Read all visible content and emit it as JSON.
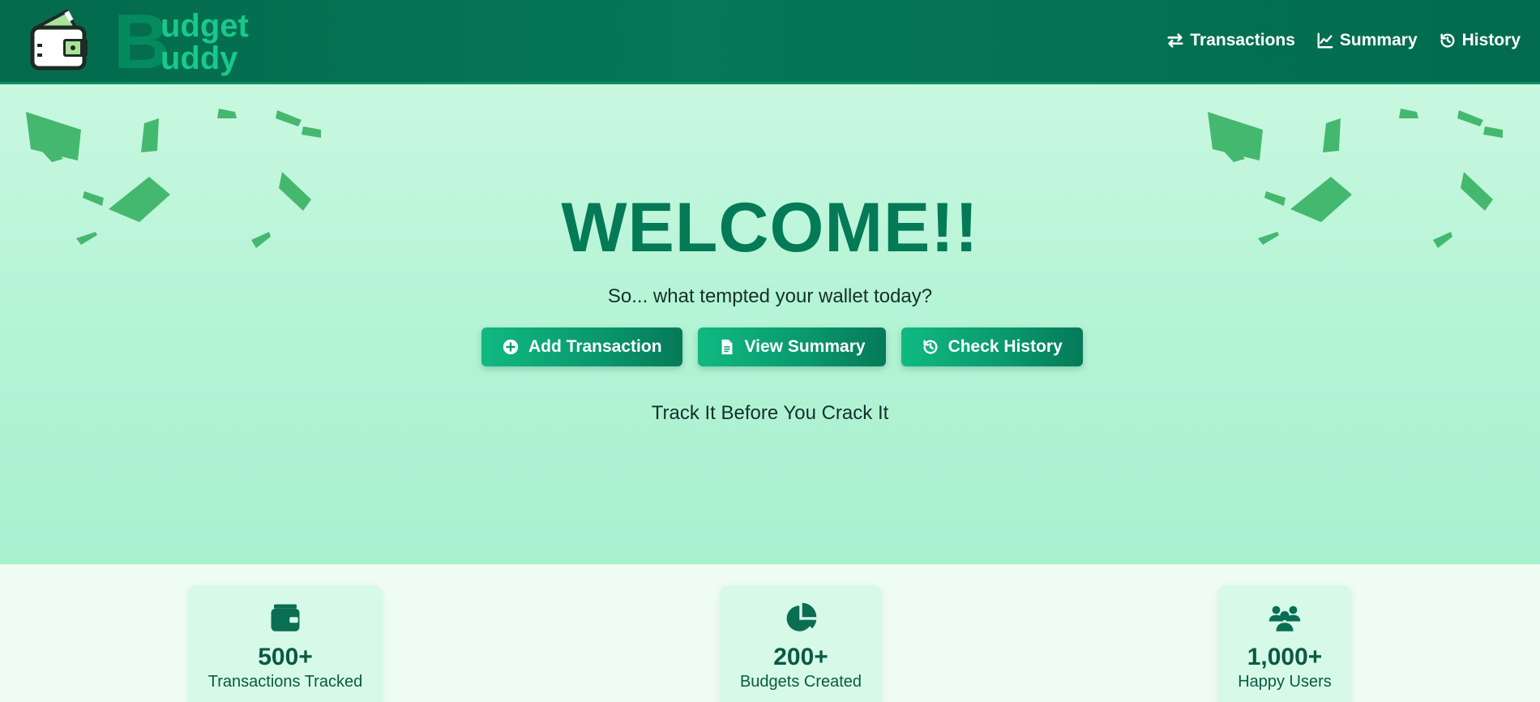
{
  "brand": {
    "initial": "B",
    "line1": "udget",
    "line2": "uddy",
    "logo_icon": "wallet-icon"
  },
  "nav": {
    "items": [
      {
        "label": "Transactions",
        "icon": "exchange-icon"
      },
      {
        "label": "Summary",
        "icon": "line-chart-icon"
      },
      {
        "label": "History",
        "icon": "history-icon"
      }
    ]
  },
  "hero": {
    "title": "WELCOME!!",
    "subtitle": "So... what tempted your wallet today?",
    "buttons": [
      {
        "label": "Add Transaction",
        "icon": "plus-circle-icon"
      },
      {
        "label": "View Summary",
        "icon": "file-icon"
      },
      {
        "label": "Check History",
        "icon": "history-icon"
      }
    ],
    "motto": "Track It Before You Crack It"
  },
  "stats": [
    {
      "value": "500+",
      "label": "Transactions Tracked",
      "icon": "wallet-icon"
    },
    {
      "value": "200+",
      "label": "Budgets Created",
      "icon": "pie-chart-icon"
    },
    {
      "value": "1,000+",
      "label": "Happy Users",
      "icon": "users-icon"
    }
  ],
  "colors": {
    "nav_bg": "#047857",
    "accent": "#10b981",
    "title": "#047a57",
    "hero_bg": "#c9f8e0"
  }
}
